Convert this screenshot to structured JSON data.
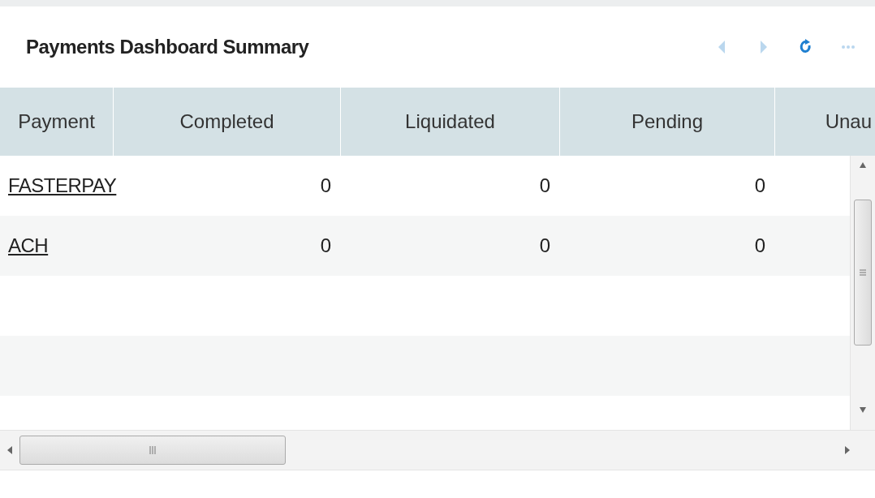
{
  "panel": {
    "title": "Payments Dashboard Summary"
  },
  "toolbar": [
    {
      "kind": "prev",
      "disabled": true
    },
    {
      "kind": "next",
      "disabled": true
    },
    {
      "kind": "refresh",
      "disabled": false
    },
    {
      "kind": "more",
      "disabled": true
    }
  ],
  "table": {
    "columns": [
      "Payment",
      "Completed",
      "Liquidated",
      "Pending",
      "Unau"
    ],
    "rows": [
      {
        "payment": "FASTERPAY",
        "values": [
          "0",
          "0",
          "0"
        ]
      },
      {
        "payment": "ACH",
        "values": [
          "0",
          "0",
          "0"
        ]
      }
    ]
  }
}
